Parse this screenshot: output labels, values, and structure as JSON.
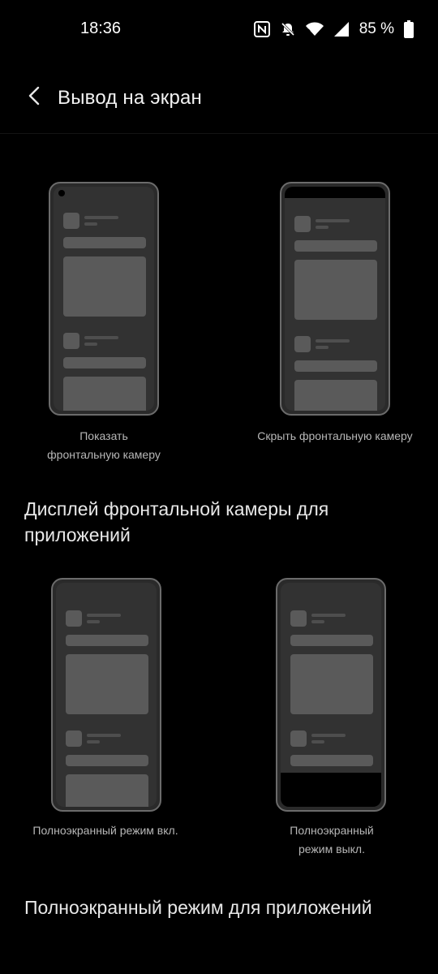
{
  "status_bar": {
    "time": "18:36",
    "battery_percent": "85 %",
    "icons": [
      "nfc-icon",
      "notifications-off-icon",
      "wifi-icon",
      "signal-icon",
      "battery-icon"
    ]
  },
  "header": {
    "back_icon": "chevron-left-icon",
    "title": "Вывод на экран"
  },
  "camera_options": [
    {
      "label": "Показать\nфронтальную камеру"
    },
    {
      "label": "Скрыть фронтальную камеру"
    }
  ],
  "section_app_camera": {
    "title": "Дисплей фронтальной камеры для приложений"
  },
  "fullscreen_options": [
    {
      "label": "Полноэкранный режим вкл."
    },
    {
      "label": "Полноэкранный\nрежим выкл."
    }
  ],
  "section_fullscreen_apps": {
    "title": "Полноэкранный режим для приложений"
  }
}
